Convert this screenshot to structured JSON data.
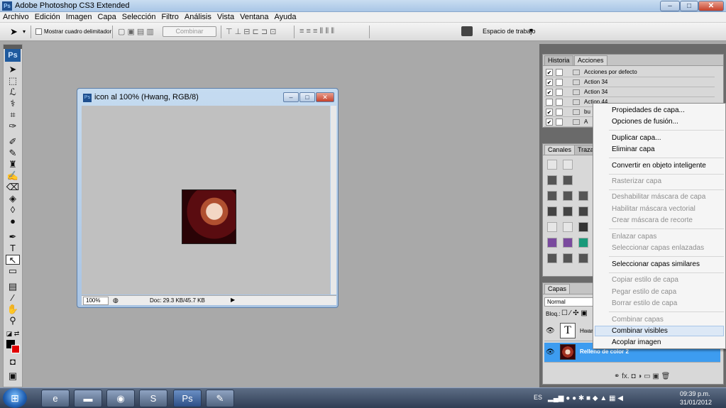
{
  "app": {
    "title": "Adobe Photoshop CS3 Extended",
    "icon": "Ps"
  },
  "window_controls": {
    "minimize": "–",
    "maximize": "□",
    "close": "✕"
  },
  "menu": [
    "Archivo",
    "Edición",
    "Imagen",
    "Capa",
    "Selección",
    "Filtro",
    "Análisis",
    "Vista",
    "Ventana",
    "Ayuda"
  ],
  "options_bar": {
    "show_bounding_box": "Mostrar cuadro delimitador",
    "combine": "Combinar",
    "workspace": "Espacio de trabajo"
  },
  "document": {
    "title": "icon al 100% (Hwang, RGB/8)",
    "zoom": "100%",
    "doc_size": "Doc: 29.3 KB/45.7 KB"
  },
  "panels": {
    "history_tab": "Historia",
    "actions_tab": "Acciones",
    "actions": [
      {
        "checked": true,
        "name": "Acciones por defecto"
      },
      {
        "checked": true,
        "name": "Action 34"
      },
      {
        "checked": true,
        "name": "Action 34"
      },
      {
        "checked": false,
        "name": "Action 44"
      },
      {
        "checked": true,
        "name": "bu"
      },
      {
        "checked": true,
        "name": "A"
      }
    ],
    "channels_tab": "Canales",
    "paths_tab": "Trazados",
    "layers_tab": "Capas",
    "blend_mode": "Normal",
    "lock_label": "Bloq.:",
    "layers": [
      {
        "name": "Hwang",
        "kind": "text",
        "thumb": "T"
      },
      {
        "name": "Relleno de color 2",
        "kind": "image"
      }
    ]
  },
  "context_menu": [
    {
      "label": "Propiedades de capa...",
      "enabled": true,
      "group": 1
    },
    {
      "label": "Opciones de fusión...",
      "enabled": true,
      "group": 1
    },
    {
      "label": "Duplicar capa...",
      "enabled": true,
      "group": 2
    },
    {
      "label": "Eliminar capa",
      "enabled": true,
      "group": 2
    },
    {
      "label": "Convertir en objeto inteligente",
      "enabled": true,
      "group": 3
    },
    {
      "label": "Rasterizar capa",
      "enabled": false,
      "group": 4
    },
    {
      "label": "Deshabilitar máscara de capa",
      "enabled": false,
      "group": 5
    },
    {
      "label": "Habilitar máscara vectorial",
      "enabled": false,
      "group": 5
    },
    {
      "label": "Crear máscara de recorte",
      "enabled": false,
      "group": 5
    },
    {
      "label": "Enlazar capas",
      "enabled": false,
      "group": 6
    },
    {
      "label": "Seleccionar capas enlazadas",
      "enabled": false,
      "group": 6
    },
    {
      "label": "Seleccionar capas similares",
      "enabled": true,
      "group": 7
    },
    {
      "label": "Copiar estilo de capa",
      "enabled": false,
      "group": 8
    },
    {
      "label": "Pegar estilo de capa",
      "enabled": false,
      "group": 8
    },
    {
      "label": "Borrar estilo de capa",
      "enabled": false,
      "group": 8
    },
    {
      "label": "Combinar capas",
      "enabled": false,
      "group": 9
    },
    {
      "label": "Combinar visibles",
      "enabled": true,
      "group": 9,
      "highlighted": true
    },
    {
      "label": "Acoplar imagen",
      "enabled": true,
      "group": 9
    }
  ],
  "taskbar": {
    "language": "ES",
    "time": "09:39 p.m.",
    "date": "31/01/2012",
    "ps_label": "Ps"
  },
  "colors": {
    "accent": "#3399ff",
    "highlight": "#dce8f6",
    "selected_layer": "#3d9cf0"
  }
}
